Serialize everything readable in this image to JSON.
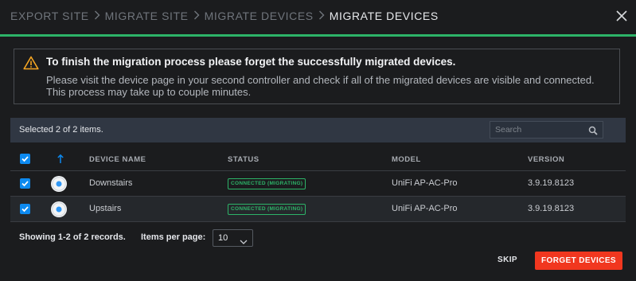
{
  "header": {
    "breadcrumb": [
      "EXPORT SITE",
      "MIGRATE SITE",
      "MIGRATE DEVICES",
      "MIGRATE DEVICES"
    ]
  },
  "alert": {
    "title": "To finish the migration process please forget the successfully migrated devices.",
    "body": "Please visit the device page in your second controller and check if all of the migrated devices are visible and connected. This process may take up to couple minutes."
  },
  "table": {
    "selection_text": "Selected 2 of 2 items.",
    "search_placeholder": "Search",
    "columns": [
      "DEVICE NAME",
      "STATUS",
      "MODEL",
      "VERSION"
    ],
    "rows": [
      {
        "name": "Downstairs",
        "status": "CONNECTED (MIGRATING)",
        "model": "UniFi AP-AC-Pro",
        "version": "3.9.19.8123",
        "checked": true
      },
      {
        "name": "Upstairs",
        "status": "CONNECTED (MIGRATING)",
        "model": "UniFi AP-AC-Pro",
        "version": "3.9.19.8123",
        "checked": true
      }
    ]
  },
  "pagination": {
    "records_text": "Showing 1-2 of 2 records.",
    "per_page_label": "Items per page:",
    "per_page_value": "10"
  },
  "actions": {
    "skip_label": "SKIP",
    "forget_label": "FORGET DEVICES"
  },
  "colors": {
    "accent": "#2db368",
    "primary_button": "#f1371f",
    "checkbox": "#0d8af0",
    "warning": "#f5a623"
  }
}
